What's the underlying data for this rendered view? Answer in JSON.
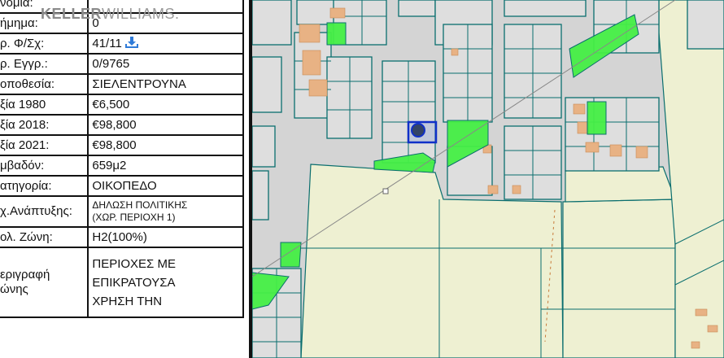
{
  "watermark": {
    "brand_bold": "KELLER",
    "brand_light": "WILLIAMS."
  },
  "rows": [
    {
      "label": "νομία:",
      "value": ""
    },
    {
      "label": "ήμημα:",
      "value": "0"
    },
    {
      "label": "ρ. Φ/Σχ:",
      "value": "41/11"
    },
    {
      "label": "ρ. Εγγρ.:",
      "value": "0/9765"
    },
    {
      "label": "οποθεσία:",
      "value": "ΣΙΕΛΕΝΤΡΟΥΝΑ"
    },
    {
      "label": "ξία 1980",
      "value": "€6,500"
    },
    {
      "label": "ξία 2018:",
      "value": "€98,800"
    },
    {
      "label": "ξία 2021:",
      "value": "€98,800"
    },
    {
      "label": "μβαδόν:",
      "value": "659μ2"
    },
    {
      "label": "ατηγορία:",
      "value": "ΟΙΚΟΠΕΔΟ"
    },
    {
      "label": "χ.Ανάπτυξης:",
      "value_line1": "ΔΗΛΩΣΗ ΠΟΛΙΤΙΚΗΣ",
      "value_line2": "(ΧΩΡ. ΠΕΡΙΟΧΗ 1)"
    },
    {
      "label": "ολ. Ζώνη:",
      "value": "H2(100%)"
    },
    {
      "label_line1": "εριγραφή",
      "label_line2": "ώνης",
      "value_line1": "ΠΕΡΙΟΧΕΣ ΜΕ",
      "value_line2": "ΕΠΙΚΡΑΤΟΥΣΑ",
      "value_line3": "ΧΡΗΣΗ ΤΗΝ"
    }
  ],
  "icons": {
    "download": "download-icon"
  },
  "colors": {
    "road": "#d4d4d4",
    "field": "#eef0d2",
    "green_zone": "#44ee44",
    "parcel_line": "#0a6e6e",
    "building": "#e8b284",
    "selected_parcel": "#1030c8",
    "marker": "#334466"
  }
}
